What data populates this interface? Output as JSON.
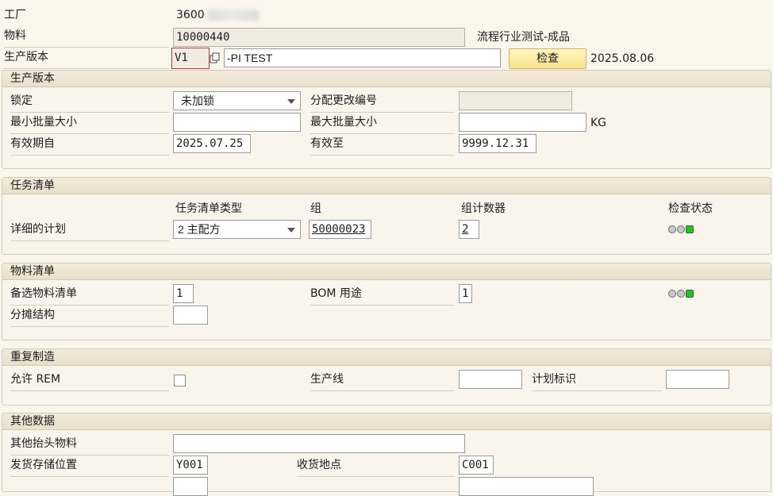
{
  "header": {
    "plant_label": "工厂",
    "plant_value": "3600",
    "material_label": "物料",
    "material_value": "10000440",
    "material_desc": "流程行业测试-成品",
    "version_label": "生产版本",
    "version_value": "V1",
    "version_text": "-PI TEST",
    "check_button": "检查",
    "check_date": "2025.08.06"
  },
  "prod_version": {
    "title": "生产版本",
    "lock_label": "锁定",
    "lock_value": "未加锁",
    "change_no_label": "分配更改编号",
    "change_no_value": "",
    "min_lot_label": "最小批量大小",
    "min_lot_value": "",
    "max_lot_label": "最大批量大小",
    "max_lot_value": "",
    "unit": "KG",
    "valid_from_label": "有效期自",
    "valid_from_value": "2025.07.25",
    "valid_to_label": "有效至",
    "valid_to_value": "9999.12.31"
  },
  "task_list": {
    "title": "任务清单",
    "col_type": "任务清单类型",
    "col_group": "组",
    "col_counter": "组计数器",
    "col_status": "检查状态",
    "row_label": "详细的计划",
    "type_value": "2 主配方",
    "group_value": "50000023",
    "counter_value": "2",
    "status_icon": "traffic-light-green"
  },
  "bom": {
    "title": "物料清单",
    "alt_bom_label": "备选物料清单",
    "alt_bom_value": "1",
    "usage_label": "BOM 用途",
    "usage_value": "1",
    "apportion_label": "分摊结构",
    "apportion_value": "",
    "status_icon": "traffic-light-green"
  },
  "rem": {
    "title": "重复制造",
    "allow_label": "允许 REM",
    "allow_checked": false,
    "line_label": "生产线",
    "line_value": "",
    "plan_id_label": "计划标识",
    "plan_id_value": ""
  },
  "other": {
    "title": "其他数据",
    "other_header_label": "其他抬头物料",
    "other_header_value": "",
    "issue_loc_label": "发货存储位置",
    "issue_loc_value": "Y001",
    "receive_label": "收货地点",
    "receive_value": "C001"
  },
  "colors": {
    "background": "#fbf6ec",
    "button": "#f7e38d",
    "status_green": "#22c321"
  }
}
